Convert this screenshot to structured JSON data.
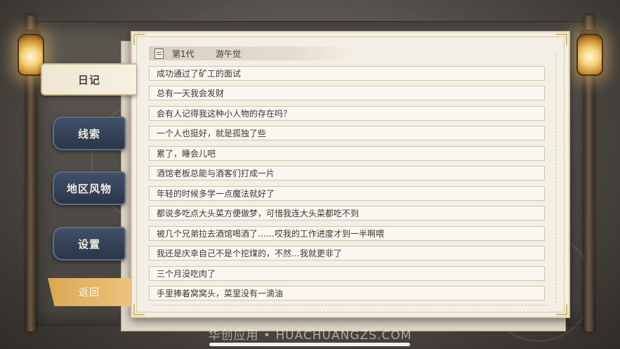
{
  "sidebar": {
    "tabs": [
      {
        "label": "日记"
      },
      {
        "label": "线索"
      },
      {
        "label": "地区风物"
      },
      {
        "label": "设置"
      }
    ],
    "back_label": "返回"
  },
  "diary": {
    "generation": "第1代",
    "name": "游午觉",
    "entries": [
      "成功通过了矿工的面试",
      "总有一天我会发财",
      "会有人记得我这种小人物的存在吗？",
      "一个人也挺好，就是孤独了些",
      "累了，睡会儿吧",
      "酒馆老板总能与酒客们打成一片",
      "年轻的时候多学一点魔法就好了",
      "都说多吃点大头菜方便做梦，可惜我连大头菜都吃不到",
      "被几个兄弟拉去酒馆喝酒了……哎我的工作进度才到一半啊喂",
      "我还是庆幸自己不是个挖煤的，不然…我就更非了",
      "三个月没吃肉了",
      "手里捧着窝窝头，菜里没有一滴油"
    ]
  },
  "watermark": "华创应用 • HUACHUANGZS.COM",
  "icons": [
    "lantern-icon",
    "document-icon"
  ]
}
